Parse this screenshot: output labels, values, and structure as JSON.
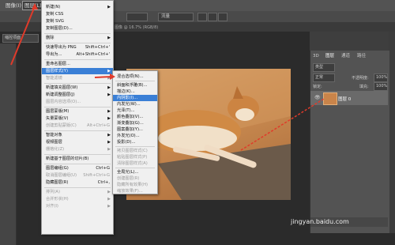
{
  "menubar": {
    "items": [
      "图像(I)",
      "图层(L)"
    ]
  },
  "options": {
    "percent_box": "",
    "mode_box": "",
    "flow_box": "流量"
  },
  "tab_title": "图像 @ 16.7% (RGB/8)",
  "left_tab": "缩控项面",
  "main_menu": {
    "items": [
      {
        "label": "新建(N)",
        "shortcut": "",
        "sub": true,
        "state": "normal"
      },
      {
        "label": "复制 CSS",
        "shortcut": "",
        "sub": false,
        "state": "normal"
      },
      {
        "label": "复制 SVG",
        "shortcut": "",
        "sub": false,
        "state": "normal"
      },
      {
        "label": "复制图层(D)...",
        "shortcut": "",
        "sub": false,
        "state": "normal"
      },
      {
        "label": "删除",
        "shortcut": "",
        "sub": true,
        "state": "normal"
      },
      {
        "label": "快速导出为 PNG",
        "shortcut": "Shift+Ctrl+'",
        "sub": false,
        "state": "normal"
      },
      {
        "label": "导出为...",
        "shortcut": "Alt+Shift+Ctrl+'",
        "sub": false,
        "state": "normal"
      },
      {
        "label": "重命名图层...",
        "shortcut": "",
        "sub": false,
        "state": "normal"
      },
      {
        "label": "图层样式(Y)",
        "shortcut": "",
        "sub": true,
        "state": "hl"
      },
      {
        "label": "智能滤镜",
        "shortcut": "",
        "sub": true,
        "state": "dis"
      },
      {
        "label": "新建填充图层(W)",
        "shortcut": "",
        "sub": true,
        "state": "normal"
      },
      {
        "label": "新建调整图层(J)",
        "shortcut": "",
        "sub": true,
        "state": "normal"
      },
      {
        "label": "图层内容选项(O)...",
        "shortcut": "",
        "sub": false,
        "state": "dis"
      },
      {
        "label": "图层蒙版(M)",
        "shortcut": "",
        "sub": true,
        "state": "normal"
      },
      {
        "label": "矢量蒙版(V)",
        "shortcut": "",
        "sub": true,
        "state": "normal"
      },
      {
        "label": "创建剪贴蒙版(C)",
        "shortcut": "Alt+Ctrl+G",
        "sub": false,
        "state": "dis"
      },
      {
        "label": "智能对象",
        "shortcut": "",
        "sub": true,
        "state": "normal"
      },
      {
        "label": "视频图层",
        "shortcut": "",
        "sub": true,
        "state": "normal"
      },
      {
        "label": "栅格化(Z)",
        "shortcut": "",
        "sub": true,
        "state": "dis"
      },
      {
        "label": "新建基于图层的切片(B)",
        "shortcut": "",
        "sub": false,
        "state": "normal"
      },
      {
        "label": "图层编组(G)",
        "shortcut": "Ctrl+G",
        "sub": false,
        "state": "normal"
      },
      {
        "label": "取消图层编组(U)",
        "shortcut": "Shift+Ctrl+G",
        "sub": false,
        "state": "dis"
      },
      {
        "label": "隐藏图层(R)",
        "shortcut": "Ctrl+,",
        "sub": false,
        "state": "normal"
      },
      {
        "label": "排列(A)",
        "shortcut": "",
        "sub": true,
        "state": "dis"
      },
      {
        "label": "合并形状(H)",
        "shortcut": "",
        "sub": true,
        "state": "dis"
      },
      {
        "label": "对齐(I)",
        "shortcut": "",
        "sub": true,
        "state": "dis"
      }
    ]
  },
  "sub_menu": {
    "items": [
      {
        "label": "混合选项(N)...",
        "state": "normal"
      },
      {
        "label": "斜面和浮雕(B)...",
        "state": "normal"
      },
      {
        "label": "描边(K)...",
        "state": "normal"
      },
      {
        "label": "内阴影(I)...",
        "state": "hl"
      },
      {
        "label": "内发光(W)...",
        "state": "normal"
      },
      {
        "label": "光泽(T)...",
        "state": "normal"
      },
      {
        "label": "颜色叠加(V)...",
        "state": "normal"
      },
      {
        "label": "渐变叠加(G)...",
        "state": "normal"
      },
      {
        "label": "图案叠加(Y)...",
        "state": "normal"
      },
      {
        "label": "外发光(O)...",
        "state": "normal"
      },
      {
        "label": "投影(D)...",
        "state": "normal"
      },
      {
        "label": "拷贝图层样式(C)",
        "state": "dis"
      },
      {
        "label": "粘贴图层样式(P)",
        "state": "dis"
      },
      {
        "label": "清除图层样式(A)",
        "state": "dis"
      },
      {
        "label": "全局光(L)...",
        "state": "normal"
      },
      {
        "label": "创建图层(R)",
        "state": "dis"
      },
      {
        "label": "隐藏所有效果(H)",
        "state": "dis"
      },
      {
        "label": "缩放效果(F)...",
        "state": "dis"
      }
    ]
  },
  "panel": {
    "tabs": [
      "3D",
      "图层",
      "通道",
      "路径"
    ],
    "kind_filter": "类型",
    "blend_mode": "正常",
    "opacity_label": "不透明度:",
    "opacity_value": "100%",
    "lock_label": "锁定:",
    "fill_label": "填充:",
    "fill_value": "100%",
    "layer_name": "图层 0"
  },
  "watermark": "jingyan.baidu.com",
  "colors": {
    "highlight": "#3a7fd6",
    "annotation": "#e03a2a"
  }
}
